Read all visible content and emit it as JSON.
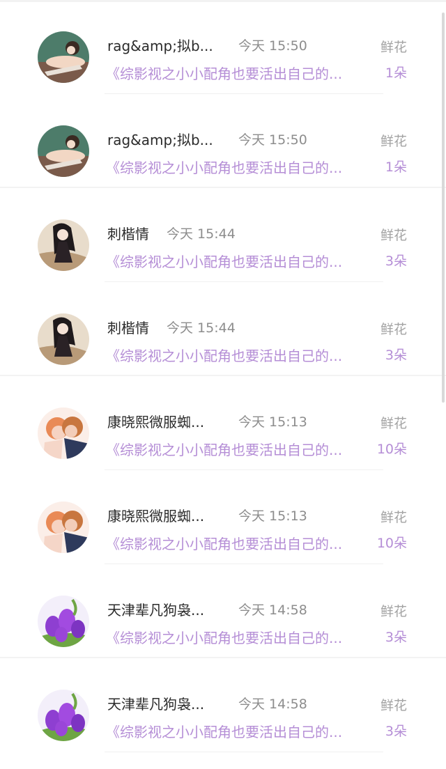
{
  "list": {
    "items": [
      {
        "name": "rag&amp;拟b...",
        "time": "今天 15:50",
        "gift_label": "鲜花",
        "book": "《综影视之小小配角也要活出自己的...",
        "count": "1朵",
        "avatar_icon": "anime-girl-lying-avatar-icon"
      },
      {
        "name": "rag&amp;拟b...",
        "time": "今天 15:50",
        "gift_label": "鲜花",
        "book": "《综影视之小小配角也要活出自己的...",
        "count": "1朵",
        "avatar_icon": "anime-girl-lying-avatar-icon"
      },
      {
        "name": "刺楷情",
        "time": "今天 15:44",
        "gift_label": "鲜花",
        "book": "《综影视之小小配角也要活出自己的...",
        "count": "3朵",
        "avatar_icon": "anime-girl-dark-hair-avatar-icon"
      },
      {
        "name": "刺楷情",
        "time": "今天 15:44",
        "gift_label": "鲜花",
        "book": "《综影视之小小配角也要活出自己的...",
        "count": "3朵",
        "avatar_icon": "anime-girl-dark-hair-avatar-icon"
      },
      {
        "name": "康晓熙微服蜘...",
        "time": "今天 15:13",
        "gift_label": "鲜花",
        "book": "《综影视之小小配角也要活出自己的...",
        "count": "10朵",
        "avatar_icon": "anime-couple-avatar-icon"
      },
      {
        "name": "康晓熙微服蜘...",
        "time": "今天 15:13",
        "gift_label": "鲜花",
        "book": "《综影视之小小配角也要活出自己的...",
        "count": "10朵",
        "avatar_icon": "anime-couple-avatar-icon"
      },
      {
        "name": "天津辈凡狗袅...",
        "time": "今天 14:58",
        "gift_label": "鲜花",
        "book": "《综影视之小小配角也要活出自己的...",
        "count": "3朵",
        "avatar_icon": "purple-tulip-avatar-icon"
      },
      {
        "name": "天津辈凡狗袅...",
        "time": "今天 14:58",
        "gift_label": "鲜花",
        "book": "《综影视之小小配角也要活出自己的...",
        "count": "3朵",
        "avatar_icon": "purple-tulip-avatar-icon"
      }
    ]
  },
  "colors": {
    "accent_purple": "#b58ed6",
    "name_text": "#2b2b2b",
    "meta_text": "#8d8d8d"
  }
}
